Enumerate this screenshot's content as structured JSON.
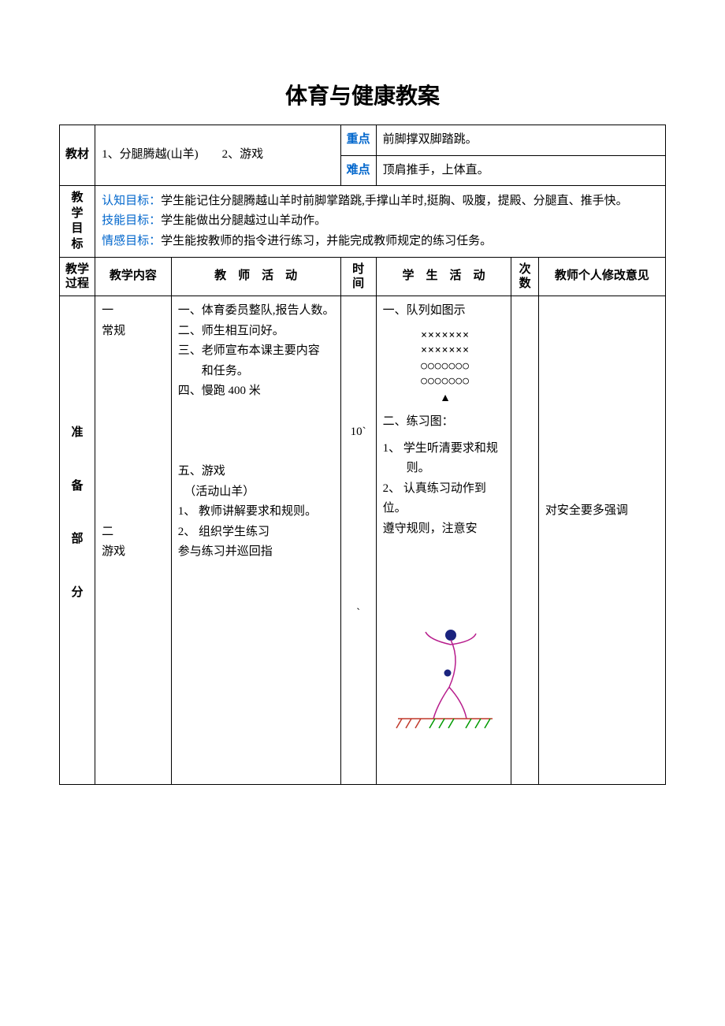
{
  "title": "体育与健康教案",
  "row_material": {
    "label": "教材",
    "content": "1、分腿腾越(山羊)　　2、游戏",
    "keypoint_label": "重点",
    "keypoint_value": "前脚撑双脚踏跳。",
    "difficulty_label": "难点",
    "difficulty_value": "顶肩推手，上体直。"
  },
  "row_goals": {
    "label": "教学目标",
    "cognitive_label": "认知目标：",
    "cognitive_value": "学生能记住分腿腾越山羊时前脚掌踏跳,手撑山羊时,挺胸、吸腹，提殿、分腿直、推手快。",
    "skill_label": "技能目标：",
    "skill_value": "学生能做出分腿越过山羊动作。",
    "affect_label": "情感目标：",
    "affect_value": "学生能按教师的指令进行练习，并能完成教师规定的练习任务。"
  },
  "headers": {
    "process": "教学过程",
    "content": "教学内容",
    "teacher": "教　师　活　动",
    "time": "时间",
    "student": "学　生　活　动",
    "count": "次数",
    "notes": "教师个人修改意见"
  },
  "section1": {
    "phase_label": "准　备　部　分",
    "content_col": "一\n常规\n\n\n\n\n\n\n\n\n\n二\n游戏",
    "teacher_col": "一、体育委员整队,报告人数。\n二、师生相互问好。\n三、老师宣布本课主要内容\n　　和任务。\n四、慢跑 400 米\n\n\n\n五、游戏\n　（活动山羊）\n1、 教师讲解要求和规则。\n2、 组织学生练习\n参与练习并巡回指",
    "time_col": "10`\n\n\n\n\n\n\n\n\n`",
    "student_heading1": "一、队列如图示",
    "formation": {
      "row1": "×××××××",
      "row2": "×××××××",
      "row3": "○○○○○○○",
      "row4": "○○○○○○○",
      "teacher_mark": "▲"
    },
    "student_heading2": "二、练习图：",
    "student_body": "1、 学生听清要求和规\n　　则。\n2、 认真练习动作到位。\n遵守规则，注意安",
    "notes_col": "对安全要多强调"
  }
}
